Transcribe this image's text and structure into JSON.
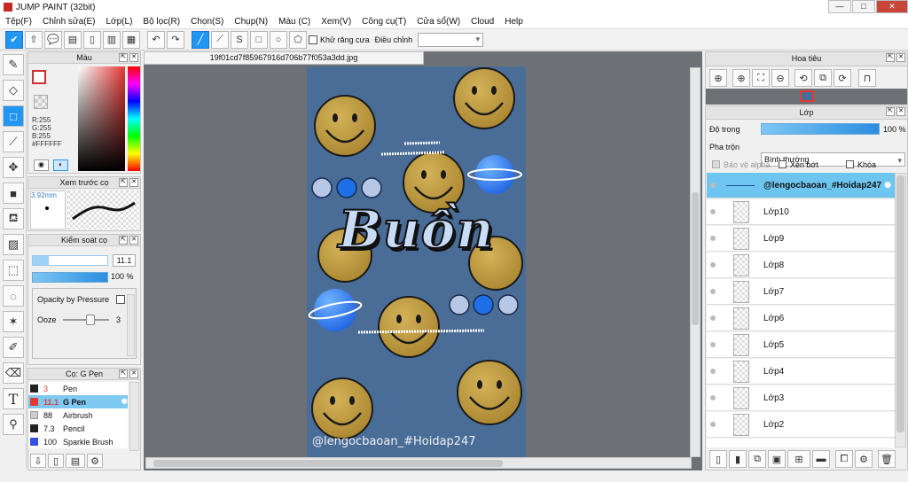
{
  "window": {
    "title": "JUMP PAINT (32bit)",
    "min": "—",
    "max": "□",
    "close": "✕"
  },
  "menu": [
    "Tệp(F)",
    "Chỉnh sửa(E)",
    "Lớp(L)",
    "Bộ lọc(R)",
    "Chọn(S)",
    "Chụp(N)",
    "Màu (C)",
    "Xem(V)",
    "Công cụ(T)",
    "Cửa sổ(W)",
    "Cloud",
    "Help"
  ],
  "toolbar": {
    "antialias_label": "Khử răng cưa",
    "adjust_label": "Điều chỉnh",
    "adjust_value": ""
  },
  "color_panel": {
    "title": "Màu",
    "r": "R:255",
    "g": "G:255",
    "b": "B:255",
    "hex": "#FFFFFF"
  },
  "brush_preview": {
    "title": "Xem trước cọ",
    "size": "3.92mm"
  },
  "brush_control": {
    "title": "Kiểm soát cọ",
    "size_value": "11.1",
    "opacity_value": "100 %",
    "opacity_pressure_label": "Opacity by Pressure",
    "ooze_label": "Ooze",
    "ooze_value": "3"
  },
  "brush_list": {
    "title": "Cọ: G Pen",
    "items": [
      {
        "size": "3",
        "name": "Pen",
        "color": "#222222"
      },
      {
        "size": "11.1",
        "name": "G Pen",
        "color": "#e53935"
      },
      {
        "size": "88",
        "name": "Airbrush",
        "color": "#cccccc"
      },
      {
        "size": "7.3",
        "name": "Pencil",
        "color": "#222222"
      },
      {
        "size": "100",
        "name": "Sparkle Brush",
        "color": "#3550e0"
      }
    ]
  },
  "document": {
    "tab": "19f01cd7f85967916d706b77f053a3dd.jpg",
    "art_text": "Buồn",
    "watermark": "@lengocbaoan_#Hoidap247"
  },
  "navigator": {
    "title": "Hoa tiêu"
  },
  "layers": {
    "title": "Lớp",
    "opacity_label": "Độ trong",
    "opacity_value": "100 %",
    "blend_label": "Pha trộn",
    "blend_value": "Bình thường",
    "protect_alpha_label": "Bảo vệ alpha",
    "clip_label": "Xén bớt",
    "lock_label": "Khóa",
    "items": [
      "@lengocbaoan_#Hoidap247",
      "Lớp10",
      "Lớp9",
      "Lớp8",
      "Lớp7",
      "Lớp6",
      "Lớp5",
      "Lớp4",
      "Lớp3",
      "Lớp2"
    ]
  },
  "colors": {
    "accent": "#2196f3",
    "artwork_bg": "#4a6d98",
    "selected_layer": "#6ec6f0"
  }
}
